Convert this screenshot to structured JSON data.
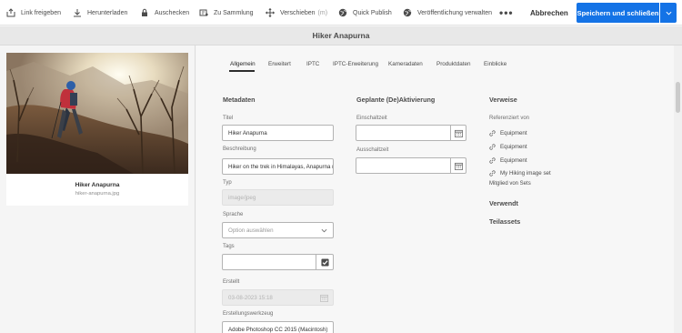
{
  "toolbar": {
    "share_label": "Link freigeben",
    "download_label": "Herunterladen",
    "checkout_label": "Auschecken",
    "collection_label": "Zu Sammlung",
    "move_label": "Verschieben",
    "move_shortcut": "(m)",
    "quick_publish_label": "Quick Publish",
    "manage_publication_label": "Veröffentlichung verwalten",
    "more_label": "•••",
    "cancel_label": "Abbrechen",
    "save_label": "Speichern und schließen",
    "accent_color": "#1473e6"
  },
  "page_title": "Hiker Anapurna",
  "asset_card": {
    "title": "Hiker Anapurna",
    "filename": "hiker-anapurna.jpg"
  },
  "tabs": [
    {
      "label": "Allgemein",
      "active": true
    },
    {
      "label": "Erweitert",
      "active": false
    },
    {
      "label": "IPTC",
      "active": false
    },
    {
      "label": "IPTC-Erweiterung",
      "active": false
    },
    {
      "label": "Kameradaten",
      "active": false
    },
    {
      "label": "Produktdaten",
      "active": false
    },
    {
      "label": "Einblicke",
      "active": false
    }
  ],
  "metadata": {
    "heading": "Metadaten",
    "title_label": "Titel",
    "title_value": "Hiker Anapurna",
    "description_label": "Beschreibung",
    "description_value": "Hiker on the trek in Himalayas, Anapurna r",
    "type_label": "Typ",
    "type_value": "image/jpeg",
    "language_label": "Sprache",
    "language_placeholder": "Option auswählen",
    "tags_label": "Tags",
    "tags_value": "",
    "created_label": "Erstellt",
    "created_value": "03-08-2023 15:18",
    "creator_tool_label": "Erstellungswerkzeug",
    "creator_tool_value": "Adobe Photoshop CC 2015 (Macintosh)"
  },
  "scheduling": {
    "heading": "Geplante (De)Aktivierung",
    "on_time_label": "Einschaltzeit",
    "on_time_value": "",
    "off_time_label": "Ausschaltzeit",
    "off_time_value": ""
  },
  "references": {
    "heading": "Verweise",
    "referenced_by_label": "Referenziert von",
    "items": [
      "Equipment",
      "Equipment",
      "Equipment",
      "My Hiking image set"
    ],
    "member_of_sets_label": "Mitglied von Sets",
    "used_heading": "Verwendt",
    "subassets_heading": "Teilassets"
  },
  "icons": {
    "share": "share-icon",
    "download": "download-icon",
    "checkout": "lock-icon",
    "collection": "collection-icon",
    "move": "move-icon",
    "publish": "globe-icon",
    "manage_publication": "globe-icon",
    "calendar": "calendar-icon",
    "checkbox": "checkbox-icon",
    "link": "link-icon",
    "chevron": "chevron-down-icon"
  }
}
